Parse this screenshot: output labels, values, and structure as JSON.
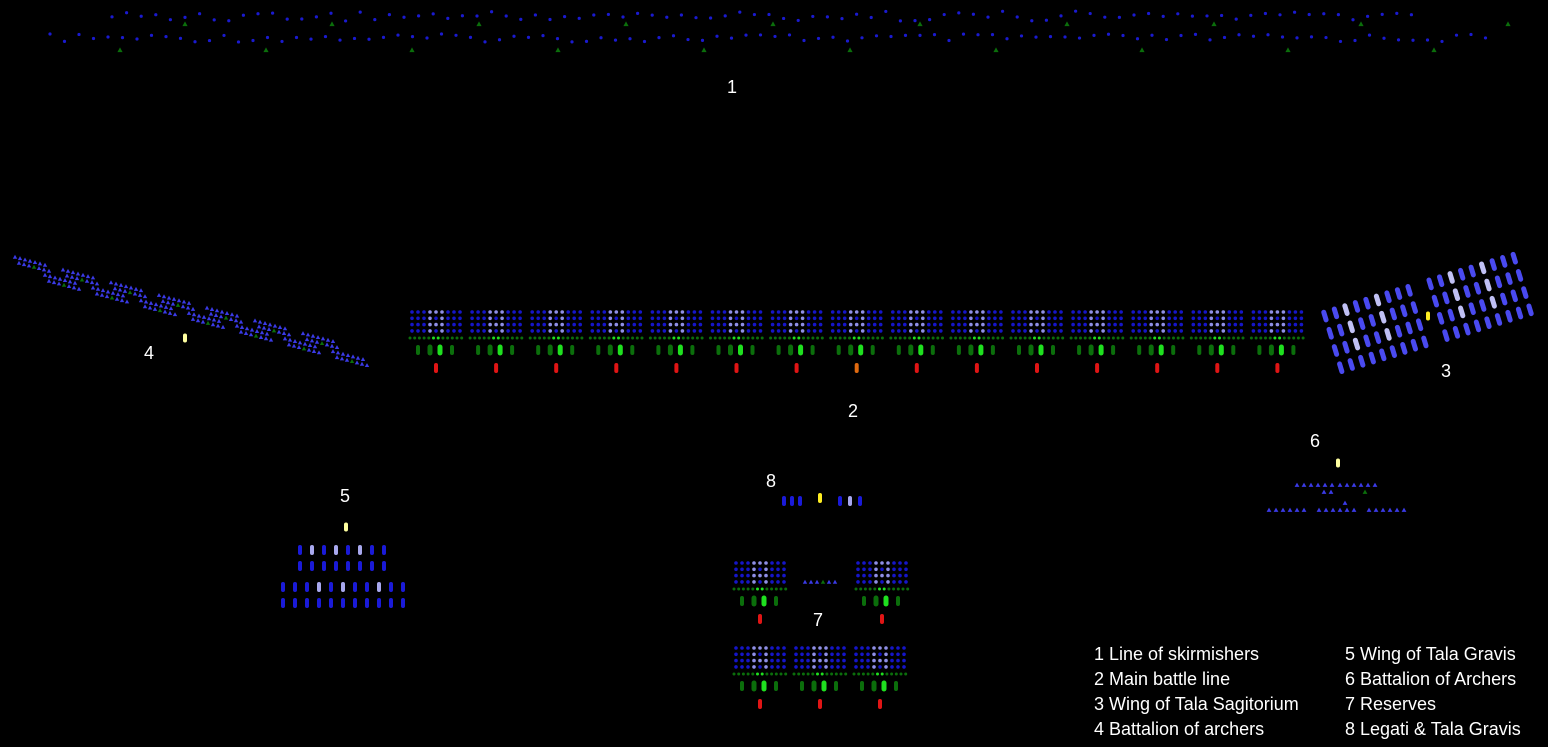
{
  "labels": {
    "l1": "1",
    "l2": "2",
    "l3": "3",
    "l4": "4",
    "l5": "5",
    "l6": "6",
    "l7": "7",
    "l8": "8"
  },
  "legend": {
    "col1": [
      "1 Line of skirmishers",
      "2 Main battle line",
      "3 Wing of Tala Sagitorium",
      "4 Battalion of archers"
    ],
    "col2": [
      "5 Wing of Tala Gravis",
      "6 Battalion of Archers",
      "7 Reserves",
      "8 Legati & Tala Gravis"
    ]
  },
  "colors": {
    "background": "#000000",
    "skirmisher": "#1a1ad0",
    "infantry_dark": "#1515c8",
    "infantry_light": "#8f8fe6",
    "cavalry": "#1a1ad8",
    "cavalry_light": "#a8a8ee",
    "sagittarii": "#4a4af0",
    "sagittarii_light": "#c0c0f4",
    "green_dark": "#0b6e0b",
    "green_bright": "#1fe01f",
    "red": "#e01515",
    "orange": "#e06a10",
    "leader": "#ffffa0",
    "leader_gold": "#ffee22",
    "archer": "#3a3ae6",
    "archer_light": "#8d8df0",
    "text": "#ffffff"
  },
  "main_line": {
    "units": 15,
    "orange_unit_index": 7
  },
  "reserves": {
    "top_row_units": 2,
    "bottom_row_units": 3
  }
}
